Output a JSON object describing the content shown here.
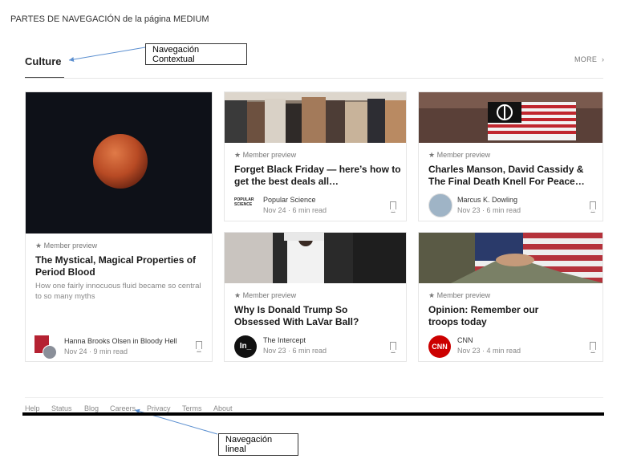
{
  "doc_title": "PARTES DE NAVEGACIÓN de la página MEDIUM",
  "callouts": {
    "contextual": "Navegación Contextual",
    "lineal": "Navegación lineal"
  },
  "section": {
    "title": "Culture",
    "more_label": "MORE",
    "more_icon": "chevron-right-icon"
  },
  "cards": [
    {
      "preview": "Member preview",
      "title": "The Mystical, Magical Properties of Period Blood",
      "description": "How one fairly innocuous fluid became so central to so many myths",
      "author": "Hanna Brooks Olsen in Bloody Hell",
      "meta": "Nov 24 · 9 min read"
    },
    {
      "preview": "Member preview",
      "title": "Forget Black Friday — here’s how to get the best deals all…",
      "author": "Popular Science",
      "logo_text": "POPULAR SCIENCE",
      "meta": "Nov 24 · 6 min read"
    },
    {
      "preview": "Member preview",
      "title": "Charles Manson, David Cassidy & The Final Death Knell For Peace…",
      "author": "Marcus K. Dowling",
      "meta": "Nov 23 · 6 min read"
    },
    {
      "preview": "Member preview",
      "title": "Why Is Donald Trump So Obsessed With LaVar Ball?",
      "author": "The Intercept",
      "logo_text": "In_",
      "meta": "Nov 23 · 6 min read"
    },
    {
      "preview": "Member preview",
      "title": "Opinion: Remember our troops today",
      "author": "CNN",
      "logo_text": "CNN",
      "meta": "Nov 23 · 4 min read"
    }
  ],
  "footer": [
    "Help",
    "Status",
    "Blog",
    "Careers",
    "Privacy",
    "Terms",
    "About"
  ],
  "colors": {
    "cnn_red": "#cc0000",
    "moon": "#c8552c"
  }
}
